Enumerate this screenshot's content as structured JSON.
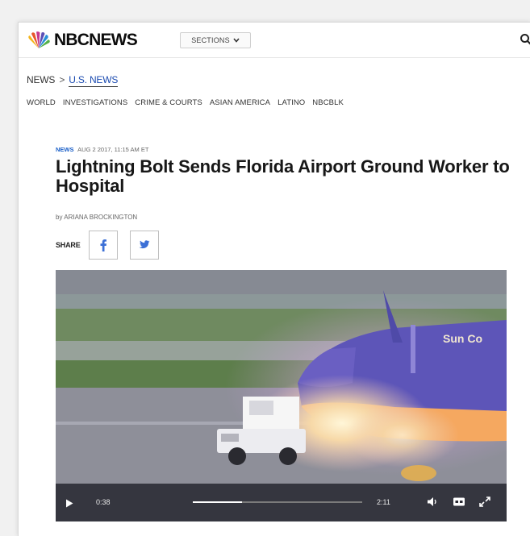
{
  "header": {
    "logo_text": "NBCNEWS",
    "sections_label": "SECTIONS",
    "search_icon": "search-icon"
  },
  "breadcrumb": {
    "root": "NEWS",
    "separator": ">",
    "current": "U.S. NEWS"
  },
  "subnav": {
    "items": [
      "WORLD",
      "INVESTIGATIONS",
      "CRIME & COURTS",
      "ASIAN AMERICA",
      "LATINO",
      "NBCBLK"
    ]
  },
  "article": {
    "category": "NEWS",
    "date": "AUG 2 2017, 11:15 AM ET",
    "headline": "Lightning Bolt Sends Florida Airport Ground Worker to Hospital",
    "byline": "by ARIANA BROCKINGTON",
    "share_label": "SHARE",
    "share_icons": [
      "facebook-icon",
      "twitter-icon"
    ]
  },
  "video": {
    "current_time": "0:38",
    "total_time": "2:11",
    "progress": 0.29,
    "controls_icons": [
      "play-icon",
      "volume-icon",
      "captions-icon",
      "fullscreen-icon"
    ],
    "aircraft_livery_text": "Sun Co"
  },
  "colors": {
    "link_blue": "#1a4ab0",
    "category_blue": "#1a5fc8",
    "share_icon_blue": "#3b6fd6",
    "headline": "#171717"
  }
}
